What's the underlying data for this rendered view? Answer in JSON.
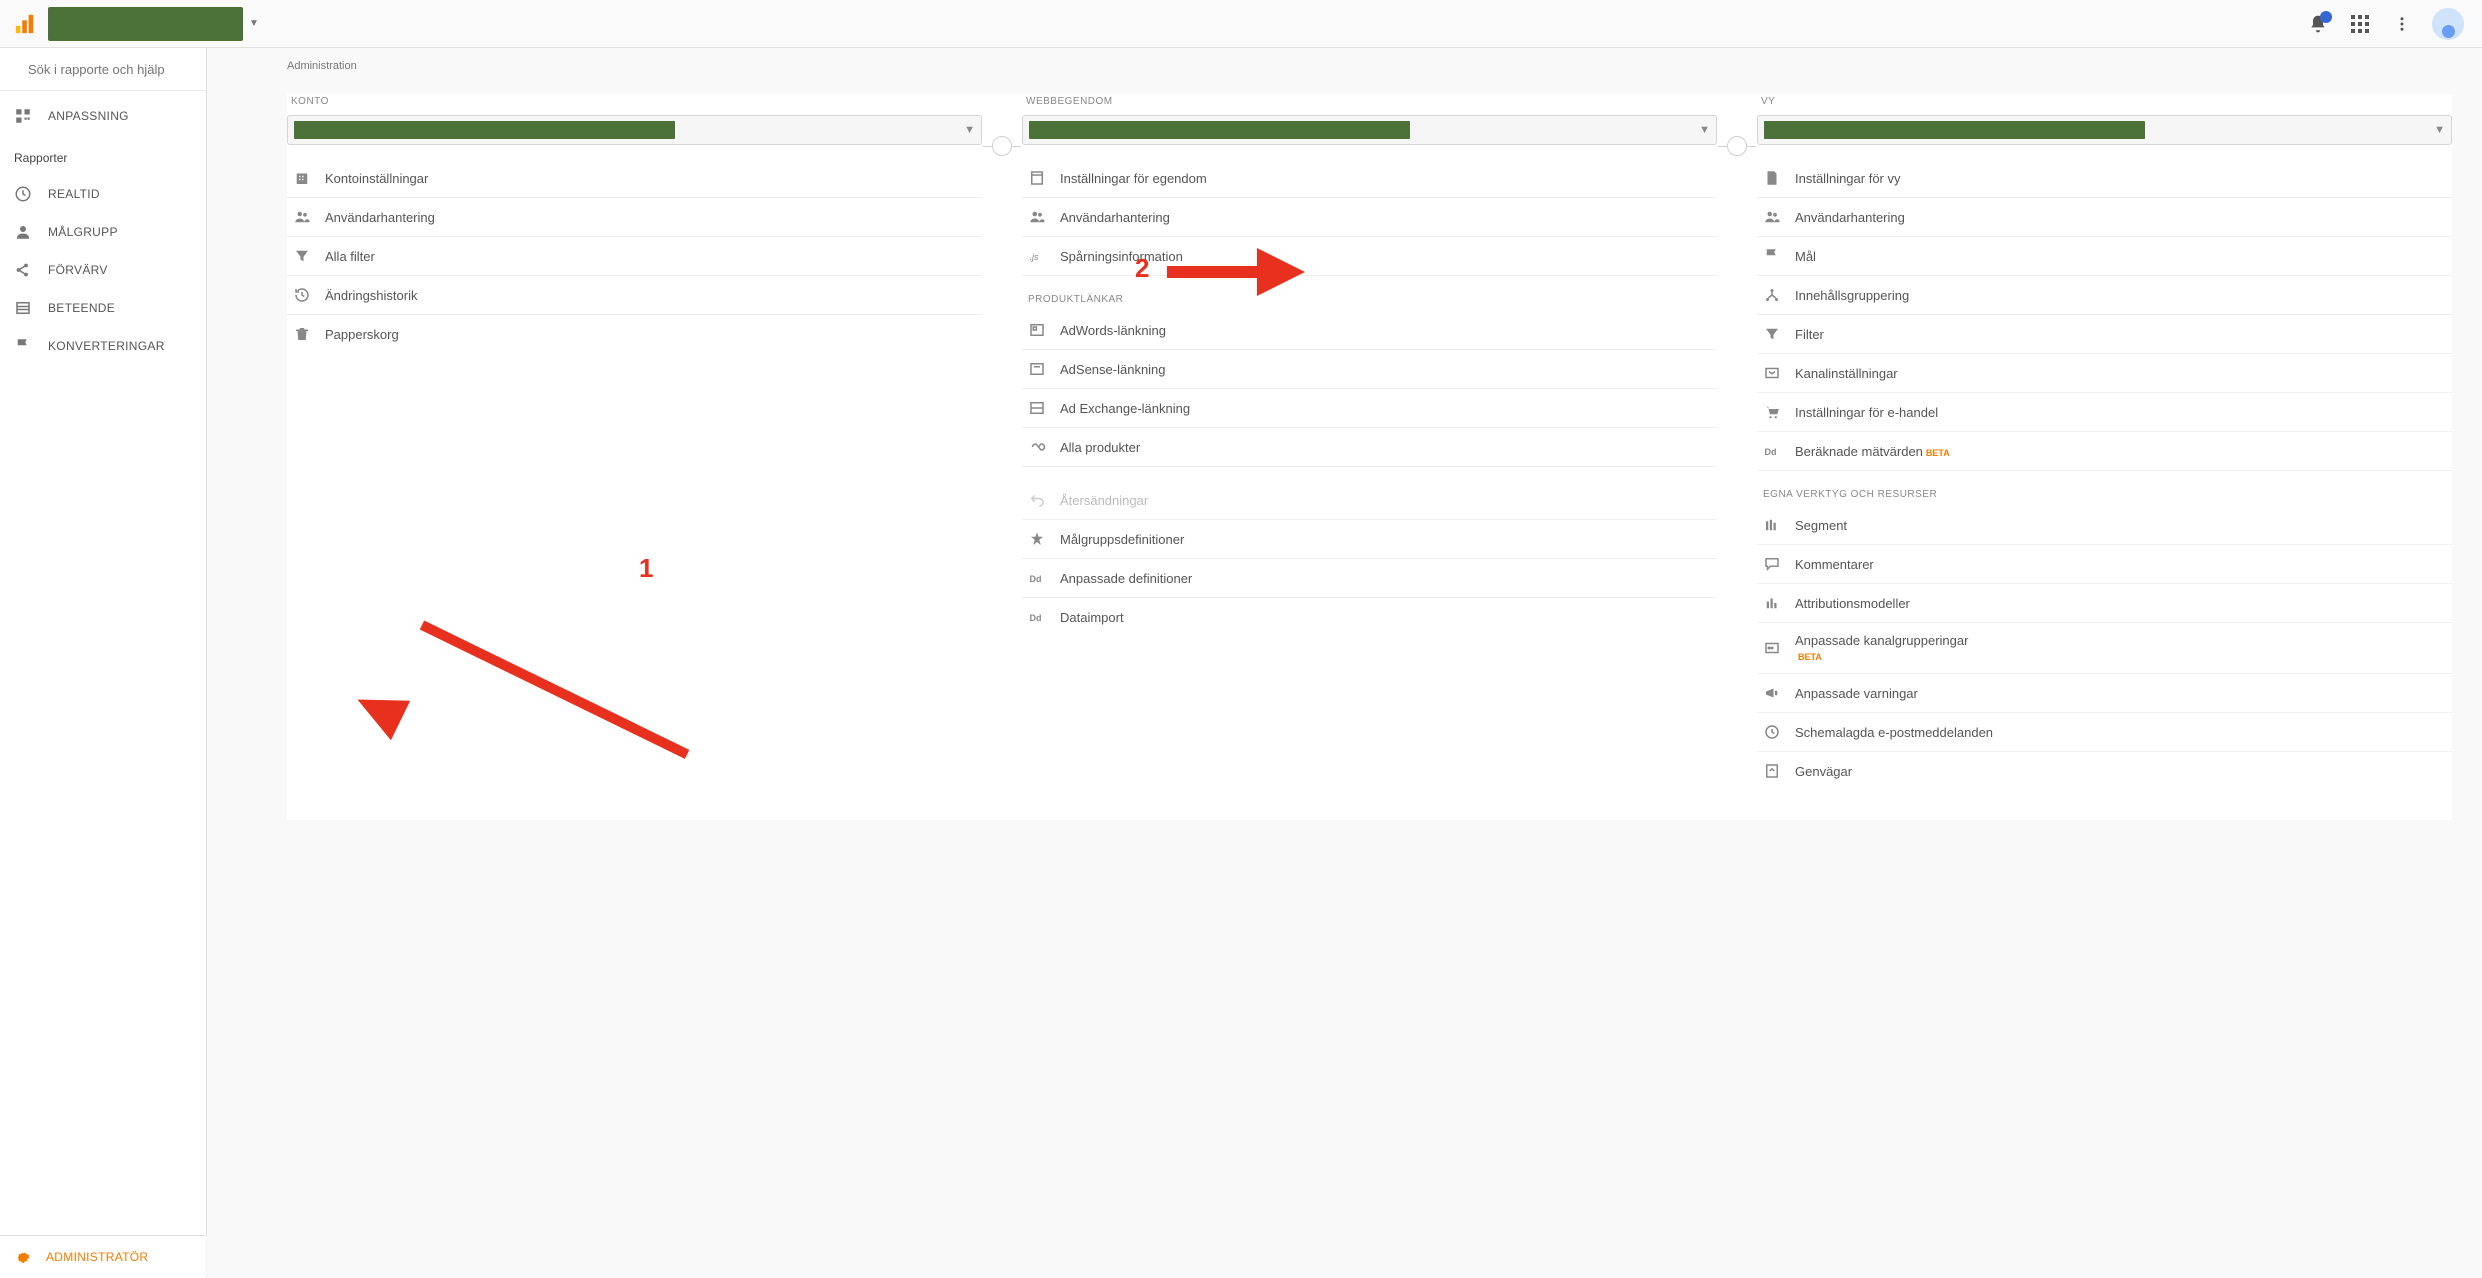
{
  "header": {
    "search_placeholder": "Sök i rapporte och hjälp"
  },
  "breadcrumb": "Administration",
  "sidebar": {
    "customization": "ANPASSNING",
    "reports_header": "Rapporter",
    "items": [
      {
        "label": "REALTID"
      },
      {
        "label": "MÅLGRUPP"
      },
      {
        "label": "FÖRVÄRV"
      },
      {
        "label": "BETEENDE"
      },
      {
        "label": "KONVERTERINGAR"
      }
    ],
    "admin": "ADMINISTRATÖR"
  },
  "columns": {
    "account": {
      "title": "KONTO",
      "items": [
        "Kontoinställningar",
        "Användarhantering",
        "Alla filter",
        "Ändringshistorik",
        "Papperskorg"
      ]
    },
    "property": {
      "title": "WEBBEGENDOM",
      "items_top": [
        "Inställningar för egendom",
        "Användarhantering",
        "Spårningsinformation"
      ],
      "section1": "PRODUKTLÄNKAR",
      "items_prod": [
        "AdWords-länkning",
        "AdSense-länkning",
        "Ad Exchange-länkning",
        "Alla produkter"
      ],
      "items_bottom": [
        "Återsändningar",
        "Målgruppsdefinitioner",
        "Anpassade definitioner",
        "Dataimport"
      ]
    },
    "view": {
      "title": "VY",
      "items_top": [
        "Inställningar för vy",
        "Användarhantering",
        "Mål",
        "Innehållsgruppering",
        "Filter",
        "Kanalinställningar",
        "Inställningar för e-handel"
      ],
      "calc_metrics": "Beräknade mätvärden",
      "section1": "EGNA VERKTYG OCH RESURSER",
      "items_tools": [
        "Segment",
        "Kommentarer",
        "Attributionsmodeller"
      ],
      "custom_channel": "Anpassade kanalgrupperingar",
      "items_last": [
        "Anpassade varningar",
        "Schemalagda e-postmeddelanden",
        "Genvägar"
      ]
    }
  },
  "beta": "BETA",
  "annotations": {
    "one": "1",
    "two": "2"
  }
}
